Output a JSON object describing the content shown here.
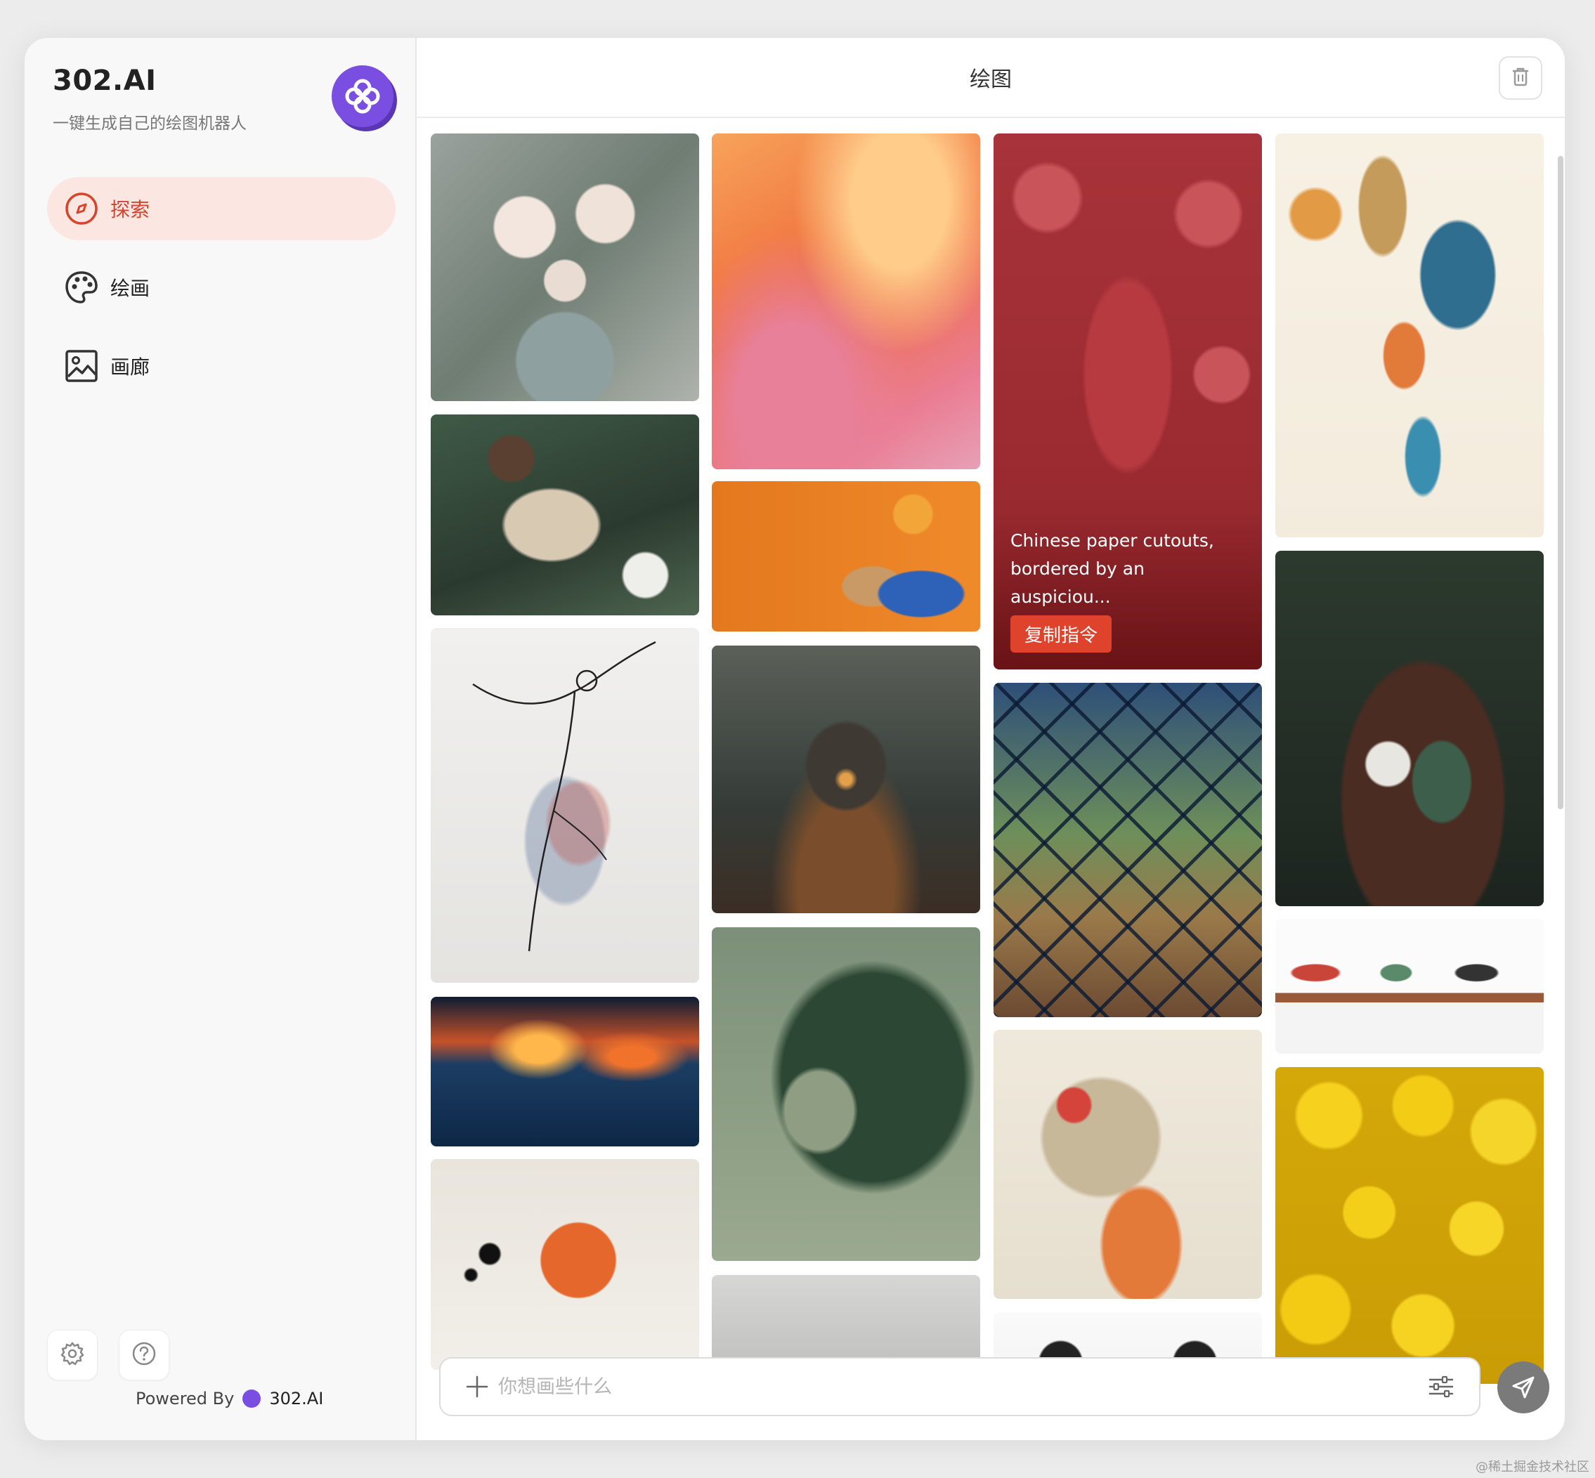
{
  "app": {
    "brand_title": "302.AI",
    "brand_subtitle": "一键生成自己的绘图机器人",
    "powered_by": "Powered By",
    "powered_brand": "302.AI"
  },
  "sidebar": {
    "items": [
      {
        "label": "探索",
        "icon": "compass-icon",
        "active": true
      },
      {
        "label": "绘画",
        "icon": "palette-icon",
        "active": false
      },
      {
        "label": "画廊",
        "icon": "image-icon",
        "active": false
      }
    ]
  },
  "header": {
    "title": "绘图"
  },
  "gallery": {
    "hover_prompt": "Chinese paper cutouts, bordered by an auspiciou...",
    "copy_button": "复制指令"
  },
  "composer": {
    "placeholder": "你想画些什么"
  },
  "watermark": "@稀土掘金技术社区",
  "colors": {
    "accent": "#d4452d",
    "active_bg": "#fbe6e1",
    "brand_purple": "#7a4ee0"
  }
}
